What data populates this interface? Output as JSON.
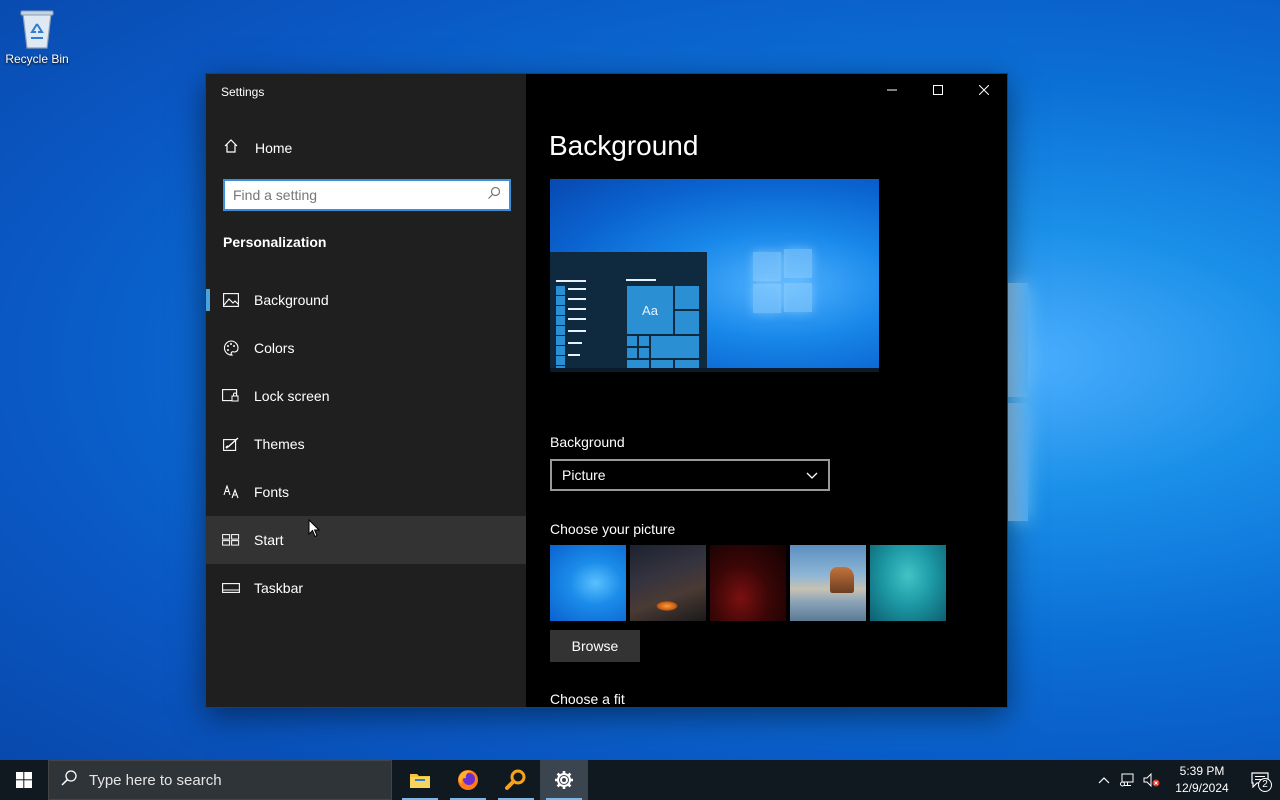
{
  "desktop": {
    "icons": [
      {
        "label": "Recycle Bin",
        "icon": "recycle-bin-icon"
      }
    ]
  },
  "window": {
    "title": "Settings",
    "controls": [
      "minimize",
      "maximize",
      "close"
    ]
  },
  "sidebar": {
    "home_label": "Home",
    "search_placeholder": "Find a setting",
    "section_title": "Personalization",
    "items": [
      {
        "label": "Background",
        "icon": "picture-icon",
        "active": true
      },
      {
        "label": "Colors",
        "icon": "palette-icon"
      },
      {
        "label": "Lock screen",
        "icon": "lock-screen-icon"
      },
      {
        "label": "Themes",
        "icon": "brush-icon"
      },
      {
        "label": "Fonts",
        "icon": "font-icon"
      },
      {
        "label": "Start",
        "icon": "start-icon",
        "hover": true
      },
      {
        "label": "Taskbar",
        "icon": "taskbar-icon"
      }
    ]
  },
  "main": {
    "title": "Background",
    "preview_tile_text": "Aa",
    "background_label": "Background",
    "background_value": "Picture",
    "choose_picture_label": "Choose your picture",
    "browse_label": "Browse",
    "choose_fit_label": "Choose a fit"
  },
  "taskbar": {
    "search_placeholder": "Type here to search",
    "apps": [
      {
        "name": "file-explorer"
      },
      {
        "name": "firefox"
      },
      {
        "name": "magnifier-app"
      },
      {
        "name": "settings",
        "active": true
      }
    ],
    "clock_time": "5:39 PM",
    "clock_date": "12/9/2024",
    "notification_count": "2"
  },
  "colors": {
    "accent": "#4aa3df",
    "sidebar_bg": "#1f1f1f",
    "main_bg": "#000000",
    "taskbar_bg": "#101820"
  }
}
